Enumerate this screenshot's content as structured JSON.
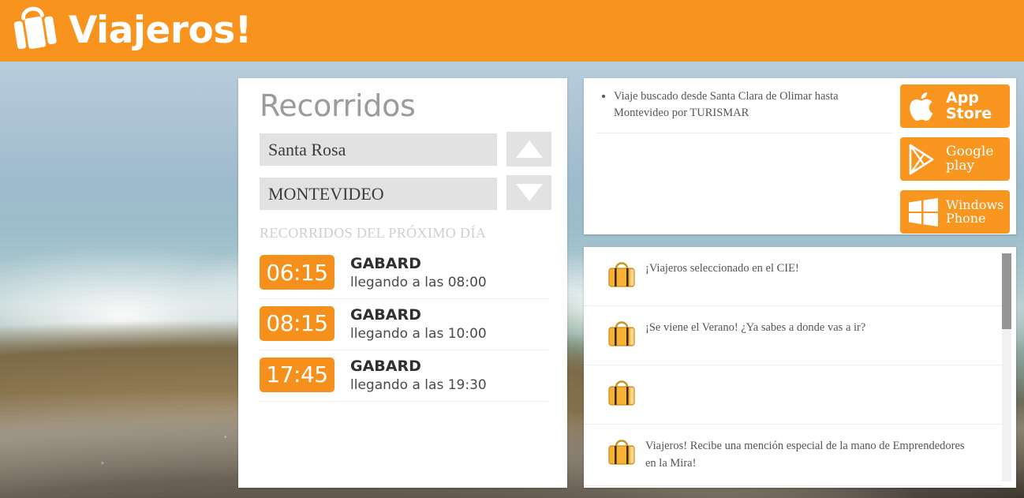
{
  "header": {
    "logo_text": "Viajeros!",
    "logo_icon": "suitcase-icon",
    "brand_color": "#f8941e"
  },
  "recorridos_panel": {
    "title": "Recorridos",
    "origin_select": {
      "value": "Santa Rosa",
      "icon": "route-origin-select"
    },
    "destination_select": {
      "value": "MONTEVIDEO",
      "icon": "route-destination-select"
    },
    "up_button_icon": "triangle-up-icon",
    "down_button_icon": "triangle-down-icon",
    "next_day_label": "RECORRIDOS DEL PRÓXIMO DÍA",
    "schedule": [
      {
        "time": "06:15",
        "company": "GABARD",
        "arrival": "llegando a las 08:00"
      },
      {
        "time": "08:15",
        "company": "GABARD",
        "arrival": "llegando a las 10:00"
      },
      {
        "time": "17:45",
        "company": "GABARD",
        "arrival": "llegando a las 19:30"
      }
    ],
    "time_badge_color": "#f6901c"
  },
  "apps_panel": {
    "search_results": [
      "Viaje buscado desde Santa Clara de Olimar hasta Montevideo por TURISMAR"
    ],
    "store_badges": [
      {
        "id": "app-store",
        "icon": "apple-logo-icon",
        "line1": "App Store",
        "line2": ""
      },
      {
        "id": "google-play",
        "icon": "google-play-triangle-icon",
        "line1": "Google",
        "line2": "play"
      },
      {
        "id": "windows-phone",
        "icon": "windows-logo-icon",
        "line1": "Windows",
        "line2": "Phone"
      }
    ],
    "badge_color": "#f9961f"
  },
  "news_panel": {
    "items": [
      {
        "icon": "suitcase-icon",
        "text": "¡Viajeros seleccionado en el CIE!"
      },
      {
        "icon": "suitcase-icon",
        "text": "¡Se viene el Verano! ¿Ya sabes a donde vas a ir?"
      },
      {
        "icon": "suitcase-icon",
        "text": ""
      },
      {
        "icon": "suitcase-icon",
        "text": "Viajeros! Recibe una mención especial de la mano de Emprendedores en la Mira!"
      }
    ],
    "scrollbar": {
      "thumb_position": "top",
      "icon": "vertical-scrollbar"
    }
  }
}
